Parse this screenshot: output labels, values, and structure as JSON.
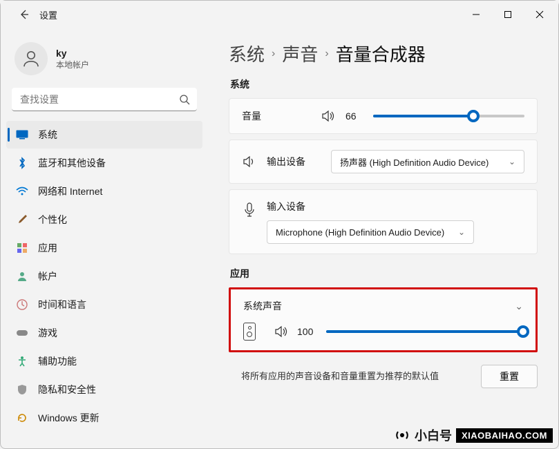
{
  "titlebar": {
    "title": "设置"
  },
  "user": {
    "name": "ky",
    "subtitle": "本地帐户"
  },
  "search": {
    "placeholder": "查找设置"
  },
  "nav": {
    "items": [
      {
        "label": "系统",
        "active": true
      },
      {
        "label": "蓝牙和其他设备"
      },
      {
        "label": "网络和 Internet"
      },
      {
        "label": "个性化"
      },
      {
        "label": "应用"
      },
      {
        "label": "帐户"
      },
      {
        "label": "时间和语言"
      },
      {
        "label": "游戏"
      },
      {
        "label": "辅助功能"
      },
      {
        "label": "隐私和安全性"
      },
      {
        "label": "Windows 更新"
      }
    ]
  },
  "breadcrumb": {
    "l1": "系统",
    "l2": "声音",
    "l3": "音量合成器"
  },
  "sections": {
    "system": "系统",
    "apps": "应用"
  },
  "system": {
    "volume_label": "音量",
    "volume_value": "66",
    "volume_pct": 66,
    "output_label": "输出设备",
    "output_selected": "扬声器 (High Definition Audio Device)",
    "input_label": "输入设备",
    "input_selected": "Microphone (High Definition Audio Device)"
  },
  "apps": {
    "title": "系统声音",
    "volume_value": "100",
    "volume_pct": 100
  },
  "reset": {
    "text": "将所有应用的声音设备和音量重置为推荐的默认值",
    "button": "重置"
  },
  "watermark": {
    "cn": "小白号",
    "en": "XIAOBAIHAO.COM"
  }
}
